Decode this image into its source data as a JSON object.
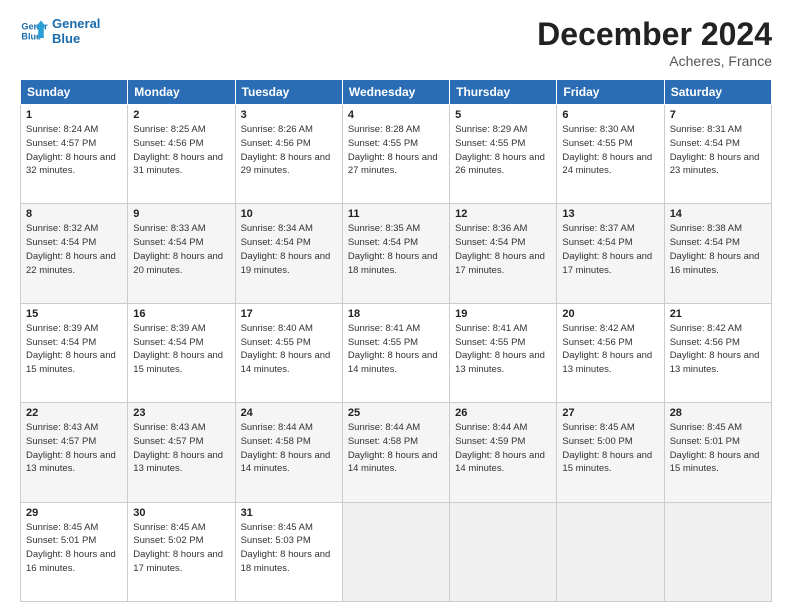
{
  "logo": {
    "line1": "General",
    "line2": "Blue"
  },
  "title": "December 2024",
  "location": "Acheres, France",
  "headers": [
    "Sunday",
    "Monday",
    "Tuesday",
    "Wednesday",
    "Thursday",
    "Friday",
    "Saturday"
  ],
  "weeks": [
    [
      {
        "day": "1",
        "sunrise": "8:24 AM",
        "sunset": "4:57 PM",
        "daylight": "8 hours and 32 minutes."
      },
      {
        "day": "2",
        "sunrise": "8:25 AM",
        "sunset": "4:56 PM",
        "daylight": "8 hours and 31 minutes."
      },
      {
        "day": "3",
        "sunrise": "8:26 AM",
        "sunset": "4:56 PM",
        "daylight": "8 hours and 29 minutes."
      },
      {
        "day": "4",
        "sunrise": "8:28 AM",
        "sunset": "4:55 PM",
        "daylight": "8 hours and 27 minutes."
      },
      {
        "day": "5",
        "sunrise": "8:29 AM",
        "sunset": "4:55 PM",
        "daylight": "8 hours and 26 minutes."
      },
      {
        "day": "6",
        "sunrise": "8:30 AM",
        "sunset": "4:55 PM",
        "daylight": "8 hours and 24 minutes."
      },
      {
        "day": "7",
        "sunrise": "8:31 AM",
        "sunset": "4:54 PM",
        "daylight": "8 hours and 23 minutes."
      }
    ],
    [
      {
        "day": "8",
        "sunrise": "8:32 AM",
        "sunset": "4:54 PM",
        "daylight": "8 hours and 22 minutes."
      },
      {
        "day": "9",
        "sunrise": "8:33 AM",
        "sunset": "4:54 PM",
        "daylight": "8 hours and 20 minutes."
      },
      {
        "day": "10",
        "sunrise": "8:34 AM",
        "sunset": "4:54 PM",
        "daylight": "8 hours and 19 minutes."
      },
      {
        "day": "11",
        "sunrise": "8:35 AM",
        "sunset": "4:54 PM",
        "daylight": "8 hours and 18 minutes."
      },
      {
        "day": "12",
        "sunrise": "8:36 AM",
        "sunset": "4:54 PM",
        "daylight": "8 hours and 17 minutes."
      },
      {
        "day": "13",
        "sunrise": "8:37 AM",
        "sunset": "4:54 PM",
        "daylight": "8 hours and 17 minutes."
      },
      {
        "day": "14",
        "sunrise": "8:38 AM",
        "sunset": "4:54 PM",
        "daylight": "8 hours and 16 minutes."
      }
    ],
    [
      {
        "day": "15",
        "sunrise": "8:39 AM",
        "sunset": "4:54 PM",
        "daylight": "8 hours and 15 minutes."
      },
      {
        "day": "16",
        "sunrise": "8:39 AM",
        "sunset": "4:54 PM",
        "daylight": "8 hours and 15 minutes."
      },
      {
        "day": "17",
        "sunrise": "8:40 AM",
        "sunset": "4:55 PM",
        "daylight": "8 hours and 14 minutes."
      },
      {
        "day": "18",
        "sunrise": "8:41 AM",
        "sunset": "4:55 PM",
        "daylight": "8 hours and 14 minutes."
      },
      {
        "day": "19",
        "sunrise": "8:41 AM",
        "sunset": "4:55 PM",
        "daylight": "8 hours and 13 minutes."
      },
      {
        "day": "20",
        "sunrise": "8:42 AM",
        "sunset": "4:56 PM",
        "daylight": "8 hours and 13 minutes."
      },
      {
        "day": "21",
        "sunrise": "8:42 AM",
        "sunset": "4:56 PM",
        "daylight": "8 hours and 13 minutes."
      }
    ],
    [
      {
        "day": "22",
        "sunrise": "8:43 AM",
        "sunset": "4:57 PM",
        "daylight": "8 hours and 13 minutes."
      },
      {
        "day": "23",
        "sunrise": "8:43 AM",
        "sunset": "4:57 PM",
        "daylight": "8 hours and 13 minutes."
      },
      {
        "day": "24",
        "sunrise": "8:44 AM",
        "sunset": "4:58 PM",
        "daylight": "8 hours and 14 minutes."
      },
      {
        "day": "25",
        "sunrise": "8:44 AM",
        "sunset": "4:58 PM",
        "daylight": "8 hours and 14 minutes."
      },
      {
        "day": "26",
        "sunrise": "8:44 AM",
        "sunset": "4:59 PM",
        "daylight": "8 hours and 14 minutes."
      },
      {
        "day": "27",
        "sunrise": "8:45 AM",
        "sunset": "5:00 PM",
        "daylight": "8 hours and 15 minutes."
      },
      {
        "day": "28",
        "sunrise": "8:45 AM",
        "sunset": "5:01 PM",
        "daylight": "8 hours and 15 minutes."
      }
    ],
    [
      {
        "day": "29",
        "sunrise": "8:45 AM",
        "sunset": "5:01 PM",
        "daylight": "8 hours and 16 minutes."
      },
      {
        "day": "30",
        "sunrise": "8:45 AM",
        "sunset": "5:02 PM",
        "daylight": "8 hours and 17 minutes."
      },
      {
        "day": "31",
        "sunrise": "8:45 AM",
        "sunset": "5:03 PM",
        "daylight": "8 hours and 18 minutes."
      },
      null,
      null,
      null,
      null
    ]
  ],
  "labels": {
    "sunrise": "Sunrise:",
    "sunset": "Sunset:",
    "daylight": "Daylight:"
  }
}
